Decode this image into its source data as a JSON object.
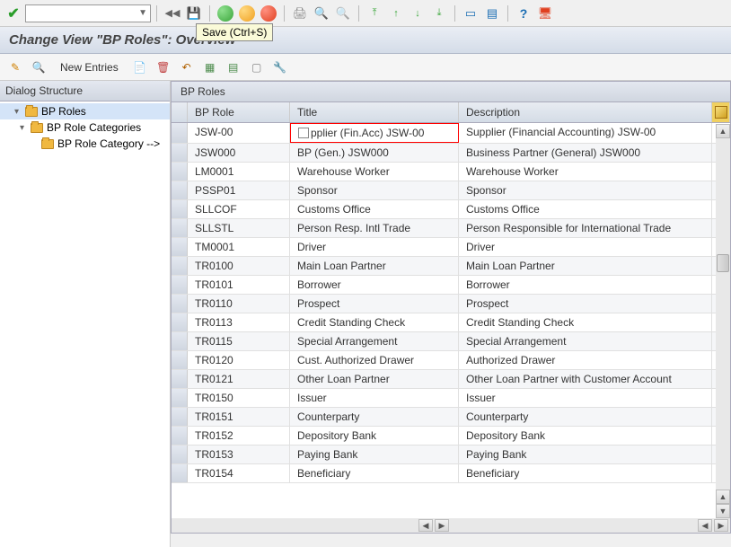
{
  "tooltip": {
    "label": "Save   (Ctrl+S)"
  },
  "page_title": "Change View \"BP Roles\": Overview",
  "actions": {
    "new_entries": "New Entries"
  },
  "tree": {
    "header": "Dialog Structure",
    "nodes": [
      {
        "label": "BP Roles",
        "selected": true
      },
      {
        "label": "BP Role Categories",
        "selected": false
      },
      {
        "label": "BP Role Category -->",
        "selected": false
      }
    ]
  },
  "grid": {
    "title": "BP Roles",
    "headers": {
      "role": "BP Role",
      "title": "Title",
      "desc": "Description"
    },
    "rows": [
      {
        "role": "JSW-00",
        "title": "pplier (Fin.Acc) JSW-00",
        "desc": "Supplier (Financial Accounting) JSW-00",
        "f4": true
      },
      {
        "role": "JSW000",
        "title": "BP (Gen.) JSW000",
        "desc": "Business Partner (General) JSW000"
      },
      {
        "role": "LM0001",
        "title": "Warehouse Worker",
        "desc": "Warehouse Worker"
      },
      {
        "role": "PSSP01",
        "title": "Sponsor",
        "desc": "Sponsor"
      },
      {
        "role": "SLLCOF",
        "title": "Customs Office",
        "desc": "Customs Office"
      },
      {
        "role": "SLLSTL",
        "title": "Person Resp. Intl Trade",
        "desc": "Person Responsible for International Trade"
      },
      {
        "role": "TM0001",
        "title": "Driver",
        "desc": "Driver"
      },
      {
        "role": "TR0100",
        "title": "Main Loan Partner",
        "desc": "Main Loan Partner"
      },
      {
        "role": "TR0101",
        "title": "Borrower",
        "desc": "Borrower"
      },
      {
        "role": "TR0110",
        "title": "Prospect",
        "desc": "Prospect"
      },
      {
        "role": "TR0113",
        "title": "Credit Standing Check",
        "desc": "Credit Standing Check"
      },
      {
        "role": "TR0115",
        "title": "Special Arrangement",
        "desc": "Special Arrangement"
      },
      {
        "role": "TR0120",
        "title": "Cust. Authorized Drawer",
        "desc": "Authorized Drawer"
      },
      {
        "role": "TR0121",
        "title": "Other Loan Partner",
        "desc": "Other Loan Partner with Customer Account"
      },
      {
        "role": "TR0150",
        "title": "Issuer",
        "desc": "Issuer"
      },
      {
        "role": "TR0151",
        "title": "Counterparty",
        "desc": "Counterparty"
      },
      {
        "role": "TR0152",
        "title": "Depository Bank",
        "desc": "Depository Bank"
      },
      {
        "role": "TR0153",
        "title": "Paying Bank",
        "desc": "Paying Bank"
      },
      {
        "role": "TR0154",
        "title": "Beneficiary",
        "desc": "Beneficiary"
      }
    ]
  }
}
